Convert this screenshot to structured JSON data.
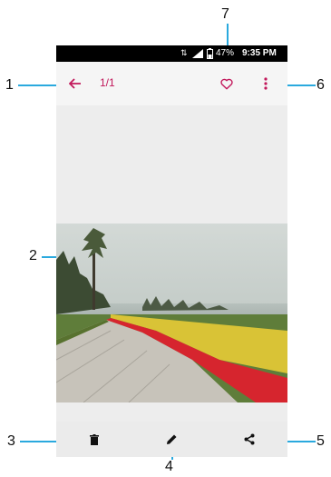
{
  "status_bar": {
    "battery": "47%",
    "time": "9:35 PM"
  },
  "toolbar": {
    "counter": "1/1",
    "back_icon": "arrow-left-icon",
    "favorite_icon": "heart-outline-icon",
    "more_icon": "more-vert-icon"
  },
  "bottom_bar": {
    "delete_icon": "trash-icon",
    "edit_icon": "pencil-icon",
    "share_icon": "share-icon"
  },
  "callouts": [
    "1",
    "2",
    "3",
    "4",
    "5",
    "6",
    "7"
  ],
  "colors": {
    "accent": "#c2185b",
    "callout_line": "#2aa9de"
  }
}
